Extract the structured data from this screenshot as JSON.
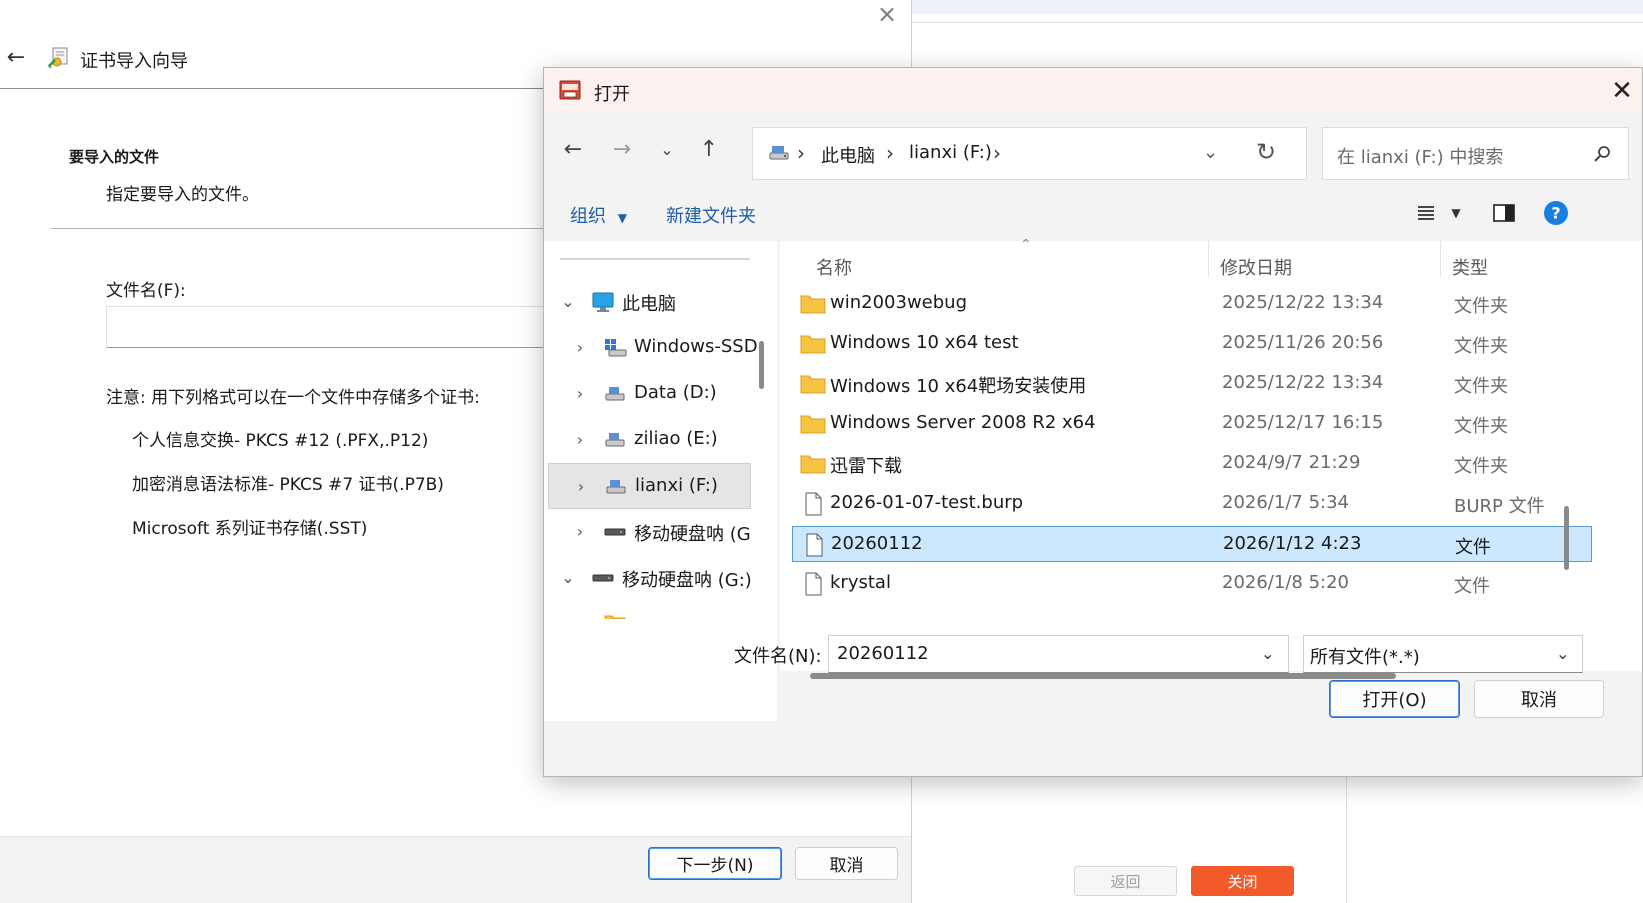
{
  "background_app": {
    "back_label": "返回",
    "close_label": "关闭",
    "close_color": "#f25a2a"
  },
  "wizard": {
    "title": "证书导入向导",
    "heading": "要导入的文件",
    "subheading": "指定要导入的文件。",
    "file_label": "文件名(F):",
    "file_value": "",
    "note": "注意: 用下列格式可以在一个文件中存储多个证书:",
    "formats": [
      "个人信息交换- PKCS #12 (.PFX,.P12)",
      "加密消息语法标准- PKCS #7 证书(.P7B)",
      "Microsoft 系列证书存储(.SST)"
    ],
    "next_label": "下一步(N)",
    "cancel_label": "取消"
  },
  "dialog": {
    "title": "打开",
    "address": [
      "此电脑",
      "lianxi (F:)"
    ],
    "search_placeholder": "在 lianxi (F:) 中搜索",
    "toolbar": {
      "organize": "组织",
      "new_folder": "新建文件夹"
    },
    "nav": [
      {
        "label": "此电脑",
        "icon": "pc-icon",
        "chevron": "⌄",
        "level": 0,
        "selected": false
      },
      {
        "label": "Windows-SSD",
        "icon": "windows-drive-icon",
        "chevron": "›",
        "level": 1,
        "selected": false
      },
      {
        "label": "Data (D:)",
        "icon": "drive-icon",
        "chevron": "›",
        "level": 1,
        "selected": false
      },
      {
        "label": "ziliao (E:)",
        "icon": "drive-icon",
        "chevron": "›",
        "level": 1,
        "selected": false
      },
      {
        "label": "lianxi (F:)",
        "icon": "drive-icon",
        "chevron": "›",
        "level": 1,
        "selected": true
      },
      {
        "label": "移动硬盘呐 (G",
        "icon": "removable-drive-icon",
        "chevron": "›",
        "level": 1,
        "selected": false
      },
      {
        "label": "移动硬盘呐 (G:)",
        "icon": "removable-drive-icon",
        "chevron": "⌄",
        "level": 0,
        "selected": false
      }
    ],
    "columns": {
      "name": "名称",
      "date": "修改日期",
      "type": "类型"
    },
    "files": [
      {
        "name": "win2003webug",
        "date": "2025/12/22 13:34",
        "type": "文件夹",
        "kind": "folder"
      },
      {
        "name": "Windows 10 x64 test",
        "date": "2025/11/26 20:56",
        "type": "文件夹",
        "kind": "folder"
      },
      {
        "name": "Windows 10 x64靶场安装使用",
        "date": "2025/12/22 13:34",
        "type": "文件夹",
        "kind": "folder"
      },
      {
        "name": "Windows Server 2008 R2 x64",
        "date": "2025/12/17 16:15",
        "type": "文件夹",
        "kind": "folder"
      },
      {
        "name": "迅雷下载",
        "date": "2024/9/7 21:29",
        "type": "文件夹",
        "kind": "folder"
      },
      {
        "name": "2026-01-07-test.burp",
        "date": "2026/1/7 5:34",
        "type": "BURP 文件",
        "kind": "file"
      },
      {
        "name": "20260112",
        "date": "2026/1/12 4:23",
        "type": "文件",
        "kind": "file",
        "selected": true
      },
      {
        "name": "krystal",
        "date": "2026/1/8 5:20",
        "type": "文件",
        "kind": "file"
      }
    ],
    "filename_label": "文件名(N):",
    "filename_value": "20260112",
    "filetype_value": "所有文件(*.*)",
    "open_label": "打开(O)",
    "cancel_label": "取消"
  }
}
